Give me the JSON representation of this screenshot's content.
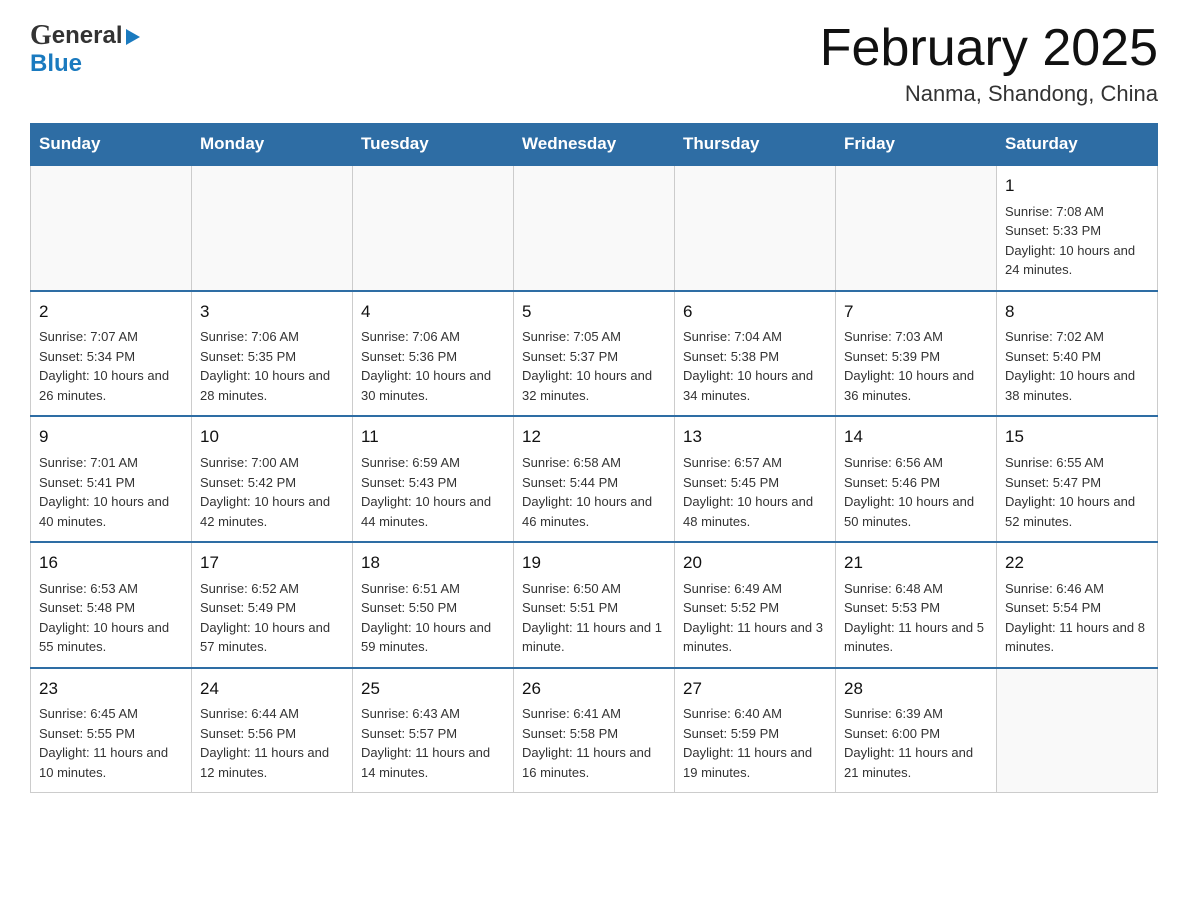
{
  "header": {
    "logo_text1": "General",
    "logo_text2": "Blue",
    "month_year": "February 2025",
    "location": "Nanma, Shandong, China"
  },
  "weekdays": [
    "Sunday",
    "Monday",
    "Tuesday",
    "Wednesday",
    "Thursday",
    "Friday",
    "Saturday"
  ],
  "weeks": [
    {
      "days": [
        {
          "number": "",
          "info": ""
        },
        {
          "number": "",
          "info": ""
        },
        {
          "number": "",
          "info": ""
        },
        {
          "number": "",
          "info": ""
        },
        {
          "number": "",
          "info": ""
        },
        {
          "number": "",
          "info": ""
        },
        {
          "number": "1",
          "info": "Sunrise: 7:08 AM\nSunset: 5:33 PM\nDaylight: 10 hours and 24 minutes."
        }
      ]
    },
    {
      "days": [
        {
          "number": "2",
          "info": "Sunrise: 7:07 AM\nSunset: 5:34 PM\nDaylight: 10 hours and 26 minutes."
        },
        {
          "number": "3",
          "info": "Sunrise: 7:06 AM\nSunset: 5:35 PM\nDaylight: 10 hours and 28 minutes."
        },
        {
          "number": "4",
          "info": "Sunrise: 7:06 AM\nSunset: 5:36 PM\nDaylight: 10 hours and 30 minutes."
        },
        {
          "number": "5",
          "info": "Sunrise: 7:05 AM\nSunset: 5:37 PM\nDaylight: 10 hours and 32 minutes."
        },
        {
          "number": "6",
          "info": "Sunrise: 7:04 AM\nSunset: 5:38 PM\nDaylight: 10 hours and 34 minutes."
        },
        {
          "number": "7",
          "info": "Sunrise: 7:03 AM\nSunset: 5:39 PM\nDaylight: 10 hours and 36 minutes."
        },
        {
          "number": "8",
          "info": "Sunrise: 7:02 AM\nSunset: 5:40 PM\nDaylight: 10 hours and 38 minutes."
        }
      ]
    },
    {
      "days": [
        {
          "number": "9",
          "info": "Sunrise: 7:01 AM\nSunset: 5:41 PM\nDaylight: 10 hours and 40 minutes."
        },
        {
          "number": "10",
          "info": "Sunrise: 7:00 AM\nSunset: 5:42 PM\nDaylight: 10 hours and 42 minutes."
        },
        {
          "number": "11",
          "info": "Sunrise: 6:59 AM\nSunset: 5:43 PM\nDaylight: 10 hours and 44 minutes."
        },
        {
          "number": "12",
          "info": "Sunrise: 6:58 AM\nSunset: 5:44 PM\nDaylight: 10 hours and 46 minutes."
        },
        {
          "number": "13",
          "info": "Sunrise: 6:57 AM\nSunset: 5:45 PM\nDaylight: 10 hours and 48 minutes."
        },
        {
          "number": "14",
          "info": "Sunrise: 6:56 AM\nSunset: 5:46 PM\nDaylight: 10 hours and 50 minutes."
        },
        {
          "number": "15",
          "info": "Sunrise: 6:55 AM\nSunset: 5:47 PM\nDaylight: 10 hours and 52 minutes."
        }
      ]
    },
    {
      "days": [
        {
          "number": "16",
          "info": "Sunrise: 6:53 AM\nSunset: 5:48 PM\nDaylight: 10 hours and 55 minutes."
        },
        {
          "number": "17",
          "info": "Sunrise: 6:52 AM\nSunset: 5:49 PM\nDaylight: 10 hours and 57 minutes."
        },
        {
          "number": "18",
          "info": "Sunrise: 6:51 AM\nSunset: 5:50 PM\nDaylight: 10 hours and 59 minutes."
        },
        {
          "number": "19",
          "info": "Sunrise: 6:50 AM\nSunset: 5:51 PM\nDaylight: 11 hours and 1 minute."
        },
        {
          "number": "20",
          "info": "Sunrise: 6:49 AM\nSunset: 5:52 PM\nDaylight: 11 hours and 3 minutes."
        },
        {
          "number": "21",
          "info": "Sunrise: 6:48 AM\nSunset: 5:53 PM\nDaylight: 11 hours and 5 minutes."
        },
        {
          "number": "22",
          "info": "Sunrise: 6:46 AM\nSunset: 5:54 PM\nDaylight: 11 hours and 8 minutes."
        }
      ]
    },
    {
      "days": [
        {
          "number": "23",
          "info": "Sunrise: 6:45 AM\nSunset: 5:55 PM\nDaylight: 11 hours and 10 minutes."
        },
        {
          "number": "24",
          "info": "Sunrise: 6:44 AM\nSunset: 5:56 PM\nDaylight: 11 hours and 12 minutes."
        },
        {
          "number": "25",
          "info": "Sunrise: 6:43 AM\nSunset: 5:57 PM\nDaylight: 11 hours and 14 minutes."
        },
        {
          "number": "26",
          "info": "Sunrise: 6:41 AM\nSunset: 5:58 PM\nDaylight: 11 hours and 16 minutes."
        },
        {
          "number": "27",
          "info": "Sunrise: 6:40 AM\nSunset: 5:59 PM\nDaylight: 11 hours and 19 minutes."
        },
        {
          "number": "28",
          "info": "Sunrise: 6:39 AM\nSunset: 6:00 PM\nDaylight: 11 hours and 21 minutes."
        },
        {
          "number": "",
          "info": ""
        }
      ]
    }
  ]
}
